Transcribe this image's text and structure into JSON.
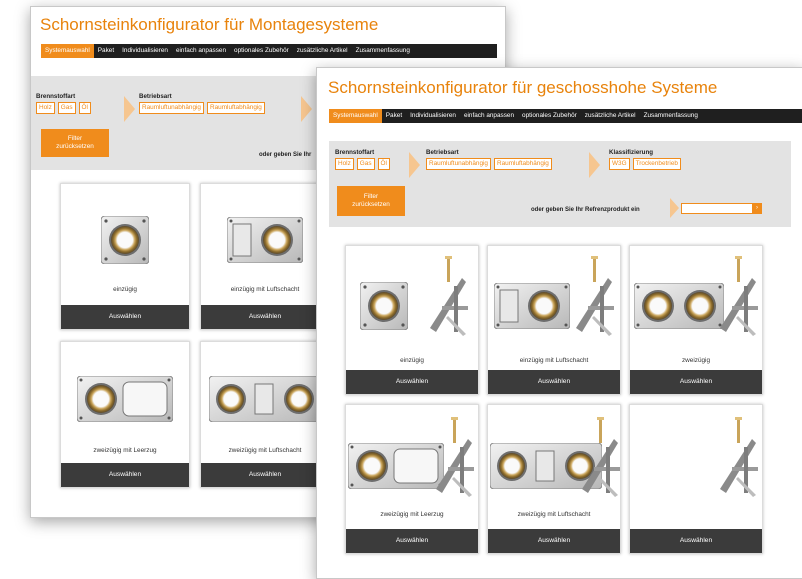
{
  "colors": {
    "accent": "#f08c1c",
    "nav_bg": "#1f1f1f",
    "filter_bg": "#e3e3e3",
    "button_bg": "#3b3b3b"
  },
  "window_back": {
    "title": "Schornsteinkonfigurator für Montagesysteme",
    "nav": [
      "Systemauswahl",
      "Paket",
      "Individualisieren",
      "einfach anpassen",
      "optionales Zubehör",
      "zusätzliche Artikel",
      "Zusammenfassung"
    ],
    "filters": {
      "fuel_label": "Brennstoffart",
      "fuel_tags": [
        "Holz",
        "Gas",
        "Öl"
      ],
      "mode_label": "Betriebsart",
      "mode_tags": [
        "Raumluftunabhängig",
        "Raumluftabhängig"
      ],
      "reset_line1": "Filter",
      "reset_line2": "zurücksetzen",
      "reference_text": "oder geben Sie Ihr"
    },
    "cards": [
      {
        "caption": "einzügig",
        "button": "Auswählen"
      },
      {
        "caption": "einzügig mit Luftschacht",
        "button": "Auswählen"
      },
      {
        "caption": "zweizügig mit Leerzug",
        "button": "Auswählen"
      },
      {
        "caption": "zweizügig mit Luftschacht",
        "button": "Auswählen"
      }
    ]
  },
  "window_front": {
    "title": "Schornsteinkonfigurator für geschosshohe Systeme",
    "nav": [
      "Systemauswahl",
      "Paket",
      "Individualisieren",
      "einfach anpassen",
      "optionales Zubehör",
      "zusätzliche Artikel",
      "Zusammenfassung"
    ],
    "filters": {
      "fuel_label": "Brennstoffart",
      "fuel_tags": [
        "Holz",
        "Gas",
        "Öl"
      ],
      "mode_label": "Betriebsart",
      "mode_tags": [
        "Raumluftunabhängig",
        "Raumluftabhängig"
      ],
      "class_label": "Klassifizierung",
      "class_tags": [
        "W3G",
        "Trockenbetrieb"
      ],
      "reset_line1": "Filter",
      "reset_line2": "zurücksetzen",
      "reference_text": "oder geben Sie Ihr Refrenzprodukt ein",
      "reference_value": ""
    },
    "cards": [
      {
        "caption": "einzügig",
        "button": "Auswählen"
      },
      {
        "caption": "einzügig mit Luftschacht",
        "button": "Auswählen"
      },
      {
        "caption": "zweizügig",
        "button": "Auswählen"
      },
      {
        "caption": "zweizügig mit Leerzug",
        "button": "Auswählen"
      },
      {
        "caption": "zweizügig mit Luftschacht",
        "button": "Auswählen"
      },
      {
        "caption": "",
        "button": "Auswählen"
      }
    ]
  }
}
